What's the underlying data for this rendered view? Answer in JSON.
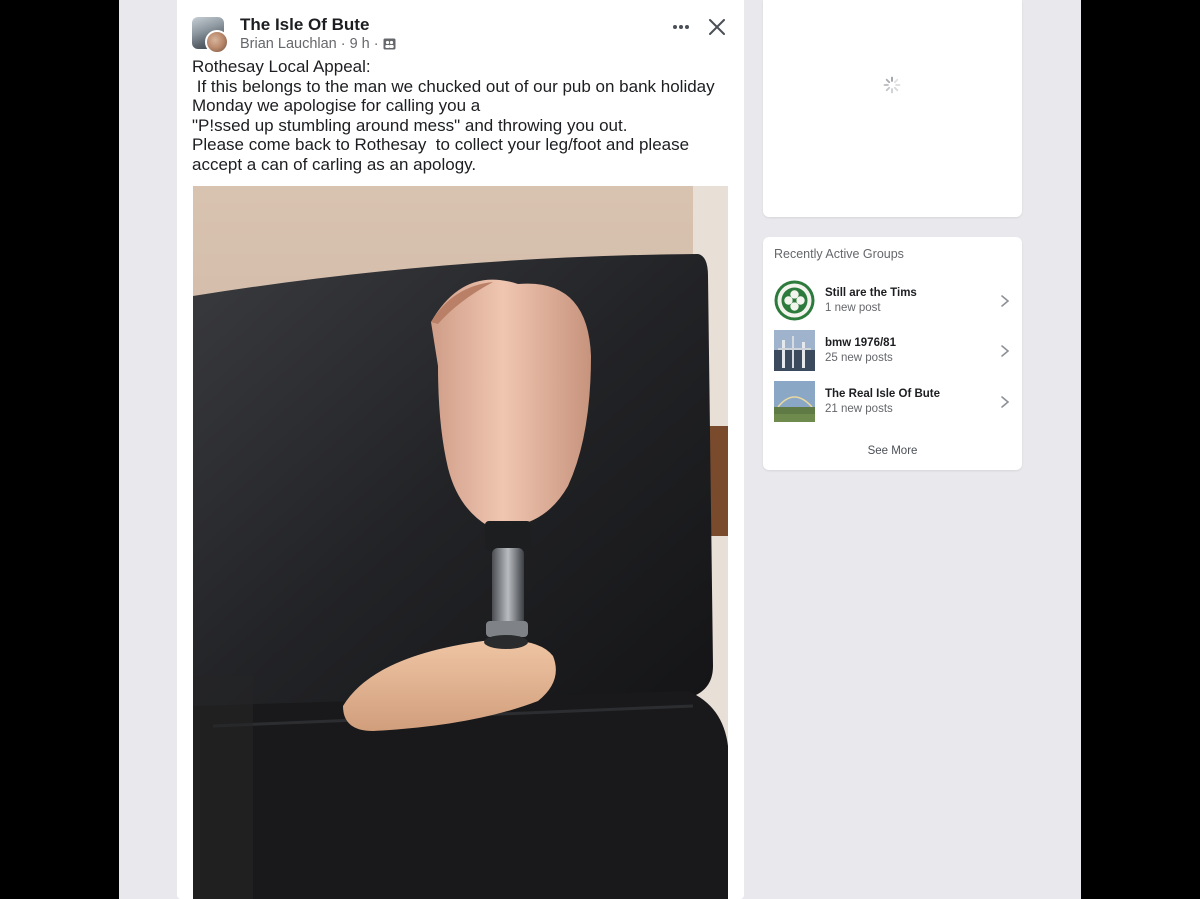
{
  "post": {
    "group_name": "The Isle Of Bute",
    "author": "Brian Lauchlan",
    "time": "9 h",
    "separator": "·",
    "text": "Rothesay Local Appeal:\n If this belongs to the man we chucked out of our pub on bank holiday\nMonday we apologise for calling you a\n\"P!ssed up stumbling around mess\" and throwing you out.\nPlease come back to Rothesay  to collect your leg/foot and please\naccept a can of carling as an apology.",
    "photo_icon": "prosthetic-leg-photo"
  },
  "sidebar": {
    "title": "Recently Active Groups",
    "groups": [
      {
        "name": "Still are the Tims",
        "sub": "1 new post"
      },
      {
        "name": "bmw 1976/81",
        "sub": "25 new posts"
      },
      {
        "name": "The Real Isle Of Bute",
        "sub": "21 new posts"
      }
    ],
    "see_more": "See More"
  },
  "colors": {
    "background": "#e9e9ed",
    "card": "#ffffff",
    "text_primary": "#1c1e21",
    "text_secondary": "#65676b"
  }
}
